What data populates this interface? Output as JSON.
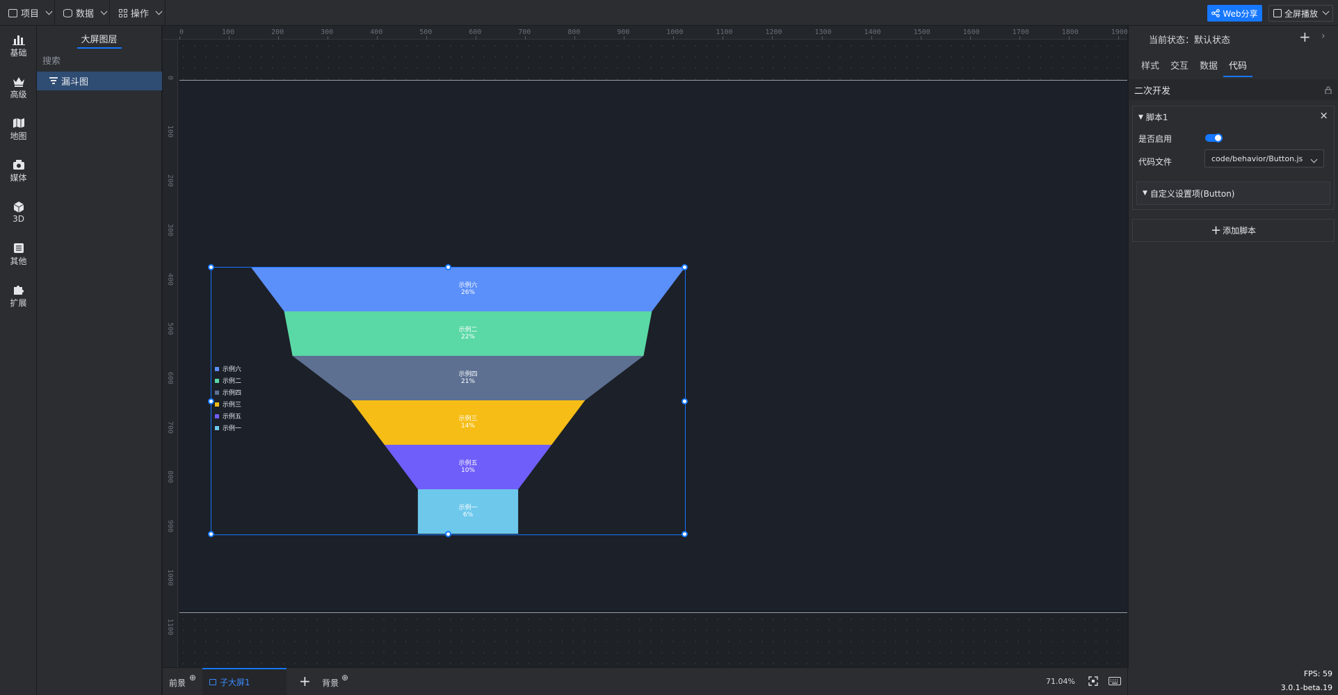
{
  "topbar": {
    "menus": [
      {
        "label": "项目"
      },
      {
        "label": "数据"
      },
      {
        "label": "操作"
      }
    ],
    "web_share": "Web分享",
    "fullscreen": "全屏播放"
  },
  "leftnav": {
    "items": [
      {
        "label": "基础",
        "icon": "bar-chart-icon"
      },
      {
        "label": "高级",
        "icon": "crown-icon"
      },
      {
        "label": "地图",
        "icon": "map-icon"
      },
      {
        "label": "媒体",
        "icon": "media-icon"
      },
      {
        "label": "3D",
        "icon": "cube-icon"
      },
      {
        "label": "其他",
        "icon": "list-icon"
      },
      {
        "label": "扩展",
        "icon": "puzzle-icon"
      }
    ]
  },
  "layers": {
    "title": "大屏图层",
    "search_placeholder": "搜索",
    "items": [
      {
        "label": "漏斗图",
        "icon": "funnel-icon"
      }
    ]
  },
  "rulers": {
    "h_ticks": [
      "0",
      "100",
      "200",
      "300",
      "400",
      "500",
      "600",
      "700",
      "800",
      "900",
      "1000",
      "1100",
      "1200",
      "1300",
      "1400",
      "1500",
      "1600",
      "1700",
      "1800",
      "1900"
    ],
    "v_ticks": [
      "0",
      "100",
      "200",
      "300",
      "400",
      "500",
      "600",
      "700",
      "800",
      "900",
      "1000",
      "1100"
    ]
  },
  "chart_data": {
    "type": "funnel",
    "categories": [
      "示例六",
      "示例二",
      "示例四",
      "示例三",
      "示例五",
      "示例一"
    ],
    "percent_labels": [
      "26%",
      "22%",
      "21%",
      "14%",
      "10%",
      "6%"
    ],
    "values": [
      26,
      22,
      21,
      14,
      10,
      6
    ],
    "colors": [
      "#5b8ff9",
      "#5ad8a6",
      "#5d7092",
      "#f6bd16",
      "#6f5ef9",
      "#6dc8ec"
    ],
    "legend": [
      "示例六",
      "示例二",
      "示例四",
      "示例三",
      "示例五",
      "示例一"
    ],
    "legend_position": "left"
  },
  "rightpanel": {
    "state_label": "当前状态：默认状态",
    "tabs": [
      "样式",
      "交互",
      "数据",
      "代码"
    ],
    "active_tab": "代码",
    "section_title": "二次开发",
    "script": {
      "name": "脚本1",
      "enable_label": "是否启用",
      "enabled": true,
      "file_label": "代码文件",
      "file_value": "code/behavior/Button.js",
      "custom_settings": "自定义设置项(Button)"
    },
    "add_script": "添加脚本"
  },
  "bottombar": {
    "foreground": "前景",
    "sub_screen": "子大屏1",
    "background": "背景",
    "zoom": "71.04%"
  },
  "status": {
    "fps": "FPS: 59",
    "version": "3.0.1-beta.19"
  },
  "colors": {
    "accent": "#1677ff",
    "panel": "#2b2d31",
    "canvas": "#1c2028"
  }
}
